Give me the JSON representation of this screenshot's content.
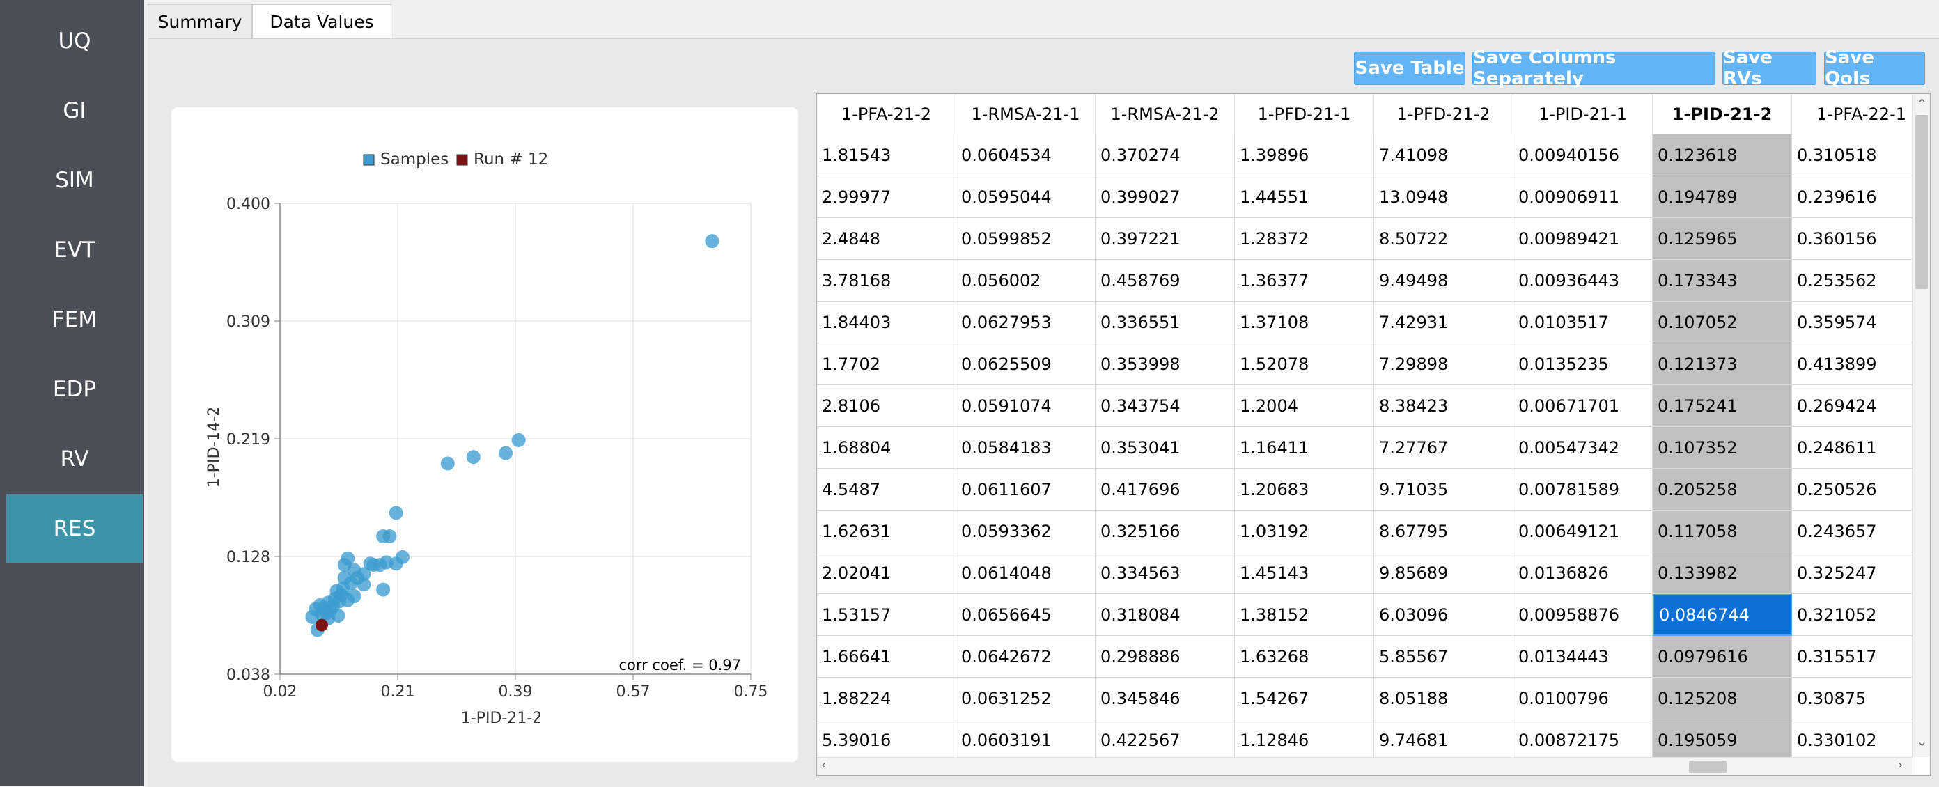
{
  "sidebar": {
    "items": [
      {
        "label": "UQ"
      },
      {
        "label": "GI"
      },
      {
        "label": "SIM"
      },
      {
        "label": "EVT"
      },
      {
        "label": "FEM"
      },
      {
        "label": "EDP"
      },
      {
        "label": "RV"
      },
      {
        "label": "RES"
      }
    ],
    "active": "RES",
    "active_color": "#3d93a7"
  },
  "tabs": [
    {
      "label": "Summary"
    },
    {
      "label": "Data Values"
    }
  ],
  "toolbar": {
    "save_table": "Save Table",
    "save_columns": "Save Columns Separately",
    "save_rvs": "Save RVs",
    "save_qois": "Save QoIs",
    "button_color": "#64b5f6"
  },
  "chart_data": {
    "type": "scatter",
    "xlabel": "1-PID-21-2",
    "ylabel": "1-PID-14-2",
    "xlim": [
      0.02,
      0.75
    ],
    "ylim": [
      0.038,
      0.4
    ],
    "xticks": [
      "0.02",
      "0.21",
      "0.39",
      "0.57",
      "0.75"
    ],
    "yticks": [
      "0.038",
      "0.128",
      "0.219",
      "0.309",
      "0.400"
    ],
    "grid": true,
    "legend_position": "top-center",
    "annotation": "corr coef. = 0.97",
    "series": [
      {
        "name": "Samples",
        "color": "#3b9ccf",
        "points": [
          [
            0.69,
            0.371
          ],
          [
            0.39,
            0.218
          ],
          [
            0.37,
            0.208
          ],
          [
            0.32,
            0.205
          ],
          [
            0.28,
            0.2
          ],
          [
            0.2,
            0.162
          ],
          [
            0.21,
            0.128
          ],
          [
            0.2,
            0.123
          ],
          [
            0.19,
            0.144
          ],
          [
            0.18,
            0.144
          ],
          [
            0.185,
            0.124
          ],
          [
            0.175,
            0.122
          ],
          [
            0.165,
            0.122
          ],
          [
            0.16,
            0.123
          ],
          [
            0.18,
            0.103
          ],
          [
            0.15,
            0.115
          ],
          [
            0.15,
            0.107
          ],
          [
            0.14,
            0.112
          ],
          [
            0.135,
            0.118
          ],
          [
            0.13,
            0.108
          ],
          [
            0.125,
            0.127
          ],
          [
            0.12,
            0.122
          ],
          [
            0.12,
            0.112
          ],
          [
            0.118,
            0.104
          ],
          [
            0.115,
            0.099
          ],
          [
            0.112,
            0.094
          ],
          [
            0.108,
            0.102
          ],
          [
            0.105,
            0.096
          ],
          [
            0.102,
            0.09
          ],
          [
            0.098,
            0.087
          ],
          [
            0.095,
            0.093
          ],
          [
            0.092,
            0.085
          ],
          [
            0.088,
            0.089
          ],
          [
            0.085,
            0.084
          ],
          [
            0.082,
            0.091
          ],
          [
            0.078,
            0.072
          ],
          [
            0.075,
            0.088
          ],
          [
            0.07,
            0.082
          ],
          [
            0.095,
            0.081
          ],
          [
            0.11,
            0.083
          ],
          [
            0.125,
            0.095
          ],
          [
            0.135,
            0.098
          ]
        ]
      },
      {
        "name": "Run # 12",
        "color": "#7b1214",
        "points": [
          [
            0.0847,
            0.0757
          ]
        ]
      }
    ]
  },
  "table": {
    "columns": [
      "1-PFA-21-2",
      "1-RMSA-21-1",
      "1-RMSA-21-2",
      "1-PFD-21-1",
      "1-PFD-21-2",
      "1-PID-21-1",
      "1-PID-21-2",
      "1-PFA-22-1"
    ],
    "selected_column": 6,
    "current_cell": [
      11,
      6
    ],
    "rows": [
      [
        "1.81543",
        "0.0604534",
        "0.370274",
        "1.39896",
        "7.41098",
        "0.00940156",
        "0.123618",
        "0.310518"
      ],
      [
        "2.99977",
        "0.0595044",
        "0.399027",
        "1.44551",
        "13.0948",
        "0.00906911",
        "0.194789",
        "0.239616"
      ],
      [
        "2.4848",
        "0.0599852",
        "0.397221",
        "1.28372",
        "8.50722",
        "0.00989421",
        "0.125965",
        "0.360156"
      ],
      [
        "3.78168",
        "0.056002",
        "0.458769",
        "1.36377",
        "9.49498",
        "0.00936443",
        "0.173343",
        "0.253562"
      ],
      [
        "1.84403",
        "0.0627953",
        "0.336551",
        "1.37108",
        "7.42931",
        "0.0103517",
        "0.107052",
        "0.359574"
      ],
      [
        "1.7702",
        "0.0625509",
        "0.353998",
        "1.52078",
        "7.29898",
        "0.0135235",
        "0.121373",
        "0.413899"
      ],
      [
        "2.8106",
        "0.0591074",
        "0.343754",
        "1.2004",
        "8.38423",
        "0.00671701",
        "0.175241",
        "0.269424"
      ],
      [
        "1.68804",
        "0.0584183",
        "0.353041",
        "1.16411",
        "7.27767",
        "0.00547342",
        "0.107352",
        "0.248611"
      ],
      [
        "4.5487",
        "0.0611607",
        "0.417696",
        "1.20683",
        "9.71035",
        "0.00781589",
        "0.205258",
        "0.250526"
      ],
      [
        "1.62631",
        "0.0593362",
        "0.325166",
        "1.03192",
        "8.67795",
        "0.00649121",
        "0.117058",
        "0.243657"
      ],
      [
        "2.02041",
        "0.0614048",
        "0.334563",
        "1.45143",
        "9.85689",
        "0.0136826",
        "0.133982",
        "0.325247"
      ],
      [
        "1.53157",
        "0.0656645",
        "0.318084",
        "1.38152",
        "6.03096",
        "0.00958876",
        "0.0846744",
        "0.321052"
      ],
      [
        "1.66641",
        "0.0642672",
        "0.298886",
        "1.63268",
        "5.85567",
        "0.0134443",
        "0.0979616",
        "0.315517"
      ],
      [
        "1.88224",
        "0.0631252",
        "0.345846",
        "1.54267",
        "8.05188",
        "0.0100796",
        "0.125208",
        "0.30875"
      ],
      [
        "5.39016",
        "0.0603191",
        "0.422567",
        "1.12846",
        "9.74681",
        "0.00872175",
        "0.195059",
        "0.330102"
      ]
    ]
  }
}
